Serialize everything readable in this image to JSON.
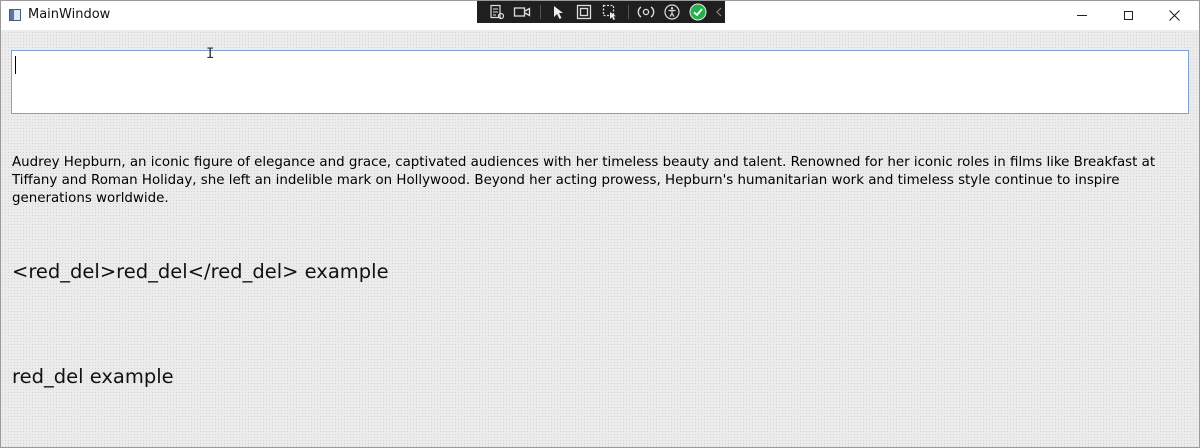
{
  "window": {
    "title": "MainWindow"
  },
  "debug_toolbar": {
    "icons": [
      "live-visual-tree-icon",
      "record-icon",
      "select-element-icon",
      "display-layout-adorners-icon",
      "track-focus-icon",
      "hot-reload-icon",
      "accessibility-icon",
      "checkmark-status-icon",
      "collapse-chevron-icon"
    ],
    "accent_color": "#22b14c"
  },
  "input": {
    "value": ""
  },
  "content": {
    "paragraph": "Audrey Hepburn, an iconic figure of elegance and grace, captivated audiences with her timeless beauty and talent. Renowned for her iconic roles in films like Breakfast at Tiffany and Roman Holiday, she left an indelible mark on Hollywood. Beyond her acting prowess, Hepburn's humanitarian work and timeless style continue to inspire generations worldwide.",
    "raw_markup_line": "<red_del>red_del</red_del> example",
    "rendered_line": "red_del example"
  }
}
